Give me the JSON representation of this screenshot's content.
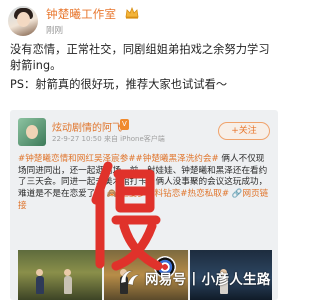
{
  "header": {
    "username": "钟楚曦工作室",
    "timestamp": "刚刚",
    "badge_icon": "crown-icon"
  },
  "post": {
    "line1": "没有恋情，正常社交，同剧组姐弟拍戏之余努力学习射箭ing。",
    "line2": "PS：射箭真的很好玩，推荐大家也试试看～"
  },
  "repost": {
    "author": "炫动剧情的阿飞",
    "author_badge": "V",
    "time": "22-9-27 10:50 来自 iPhone客户端",
    "follow_label": "+关注",
    "tag1": "#钟楚曦恋情和网红吴泽宸参#",
    "tag2": "#钟楚曦黑泽洗约会#",
    "body": "俩人不仅现场同进同出，还一起逛商场、前、射娃娃、钟楚曦和黑泽还在看约了三天会。同进一起去美术馆打卡，俩人没事聚的会议这玩成功，难道是不是在恋爱了？",
    "emoji_note": "🙈",
    "tag3": "重要多媒料钻恋#热恋",
    "tag4": "私取#",
    "link": "🔗网页链接"
  },
  "overlay": {
    "stamp_glyph": "假"
  },
  "watermark": {
    "source": "网易号",
    "divider": "|",
    "channel": "小彦人生路"
  },
  "colors": {
    "accent_orange": "#e8772e",
    "stamp_red": "#e0322b",
    "card_bg": "#eef0f2"
  }
}
